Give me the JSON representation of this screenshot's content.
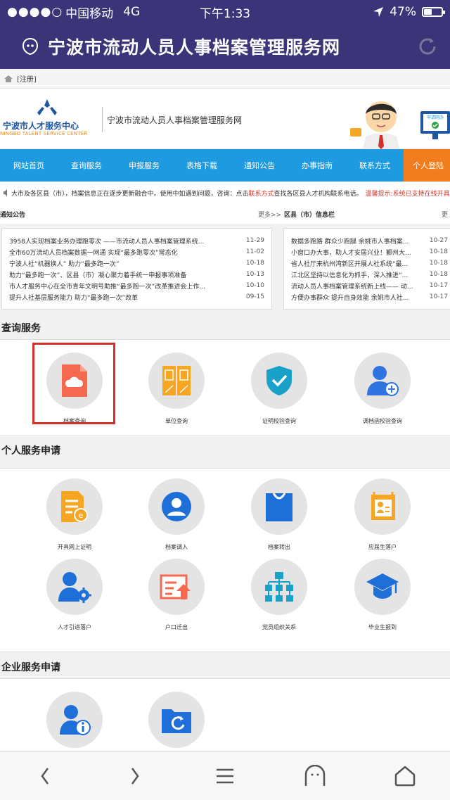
{
  "status": {
    "carrier": "中国移动",
    "network": "4G",
    "time": "下午1:33",
    "battery": "47%",
    "battery_fraction": 0.47
  },
  "app": {
    "title": "宁波市流动人员人事档案管理服务网"
  },
  "breadcrumb": {
    "text": "[注册]"
  },
  "banner": {
    "brand_cn": "宁波市人才服务中心",
    "brand_en": "NINGBO TALENT SERVICE CENTER",
    "site_name": "宁波市流动人员人事档案管理服务网",
    "mascot_screen_text": "申请网办"
  },
  "nav": [
    "网站首页",
    "查询服务",
    "申报服务",
    "表格下载",
    "通知公告",
    "办事指南",
    "联系方式",
    "个人登陆"
  ],
  "notice": {
    "text": "大市及各区县（市），档案信息正在逐步更新融合中。使用中如遇到问题，咨询：点击",
    "link": "联系方式",
    "text2": "查找各区县人才机构联系电话。",
    "tip_label": "温馨提示:",
    "tip_text": "系统已支持在线开具"
  },
  "news": {
    "left_title": "通知公告",
    "more": "更多>>",
    "right_title": "区县（市）信息栏",
    "right_more": "更",
    "left_items": [
      {
        "title": "3958人实现档案业务办理跑零次 ——市流动人员人事档案管理系统...",
        "date": "11-29"
      },
      {
        "title": "全市60万流动人员档案数据一网通 实现“最多跑零次”常态化",
        "date": "11-02"
      },
      {
        "title": "宁波人社“机器换人” 助力“最多跑一次”",
        "date": "10-18"
      },
      {
        "title": "助力“最多跑一次”、区县（市）凝心聚力着手统一申报事项准备",
        "date": "10-13"
      },
      {
        "title": "市人才服务中心在全市青年文明号助推“最多跑一次”改革推进会上作...",
        "date": "10-10"
      },
      {
        "title": "提升人社基层服务能力 助力“最多跑一次”改革",
        "date": "09-15"
      }
    ],
    "right_items": [
      {
        "title": "数据多跑路 群众少跑腿 余姚市人事档案...",
        "date": "10-27"
      },
      {
        "title": "小窗口办大事，助人才安居兴业！鄞州大...",
        "date": "10-18"
      },
      {
        "title": "省人社厅来杭州湾新区开展人社系统“最...",
        "date": "10-18"
      },
      {
        "title": "江北区坚持以信息化为抓手，深入推进“...",
        "date": "10-18"
      },
      {
        "title": "流动人员人事档案管理系统新上线—— 动...",
        "date": "10-17"
      },
      {
        "title": "方便办事群众 提升自身效能 余姚市人社...",
        "date": "10-17"
      }
    ]
  },
  "query": {
    "title": "查询服务",
    "items": [
      {
        "label": "档案查询",
        "icon": "cloud-file-icon"
      },
      {
        "label": "单位查询",
        "icon": "folders-icon"
      },
      {
        "label": "证明校验查询",
        "icon": "shield-check-icon"
      },
      {
        "label": "调档函校验查询",
        "icon": "user-add-icon"
      }
    ]
  },
  "personal": {
    "title": "个人服务申请",
    "items": [
      {
        "label": "开具网上证明",
        "icon": "document-e-icon"
      },
      {
        "label": "档案调入",
        "icon": "user-circle-icon"
      },
      {
        "label": "档案转出",
        "icon": "bag-icon"
      },
      {
        "label": "应届生落户",
        "icon": "certificate-icon"
      },
      {
        "label": "人才引进落户",
        "icon": "user-gear-icon"
      },
      {
        "label": "户口迁出",
        "icon": "document-up-icon"
      },
      {
        "label": "党员组织关系",
        "icon": "org-chart-icon"
      },
      {
        "label": "毕业生报到",
        "icon": "graduation-cap-icon"
      }
    ]
  },
  "enterprise": {
    "title": "企业服务申请",
    "items": [
      {
        "icon": "user-info-icon"
      },
      {
        "icon": "folder-sync-icon"
      }
    ]
  },
  "colors": {
    "header": "#3c3479",
    "nav": "#1e9ae0",
    "nav_active": "#f27d1e",
    "highlight": "#d4302b"
  }
}
